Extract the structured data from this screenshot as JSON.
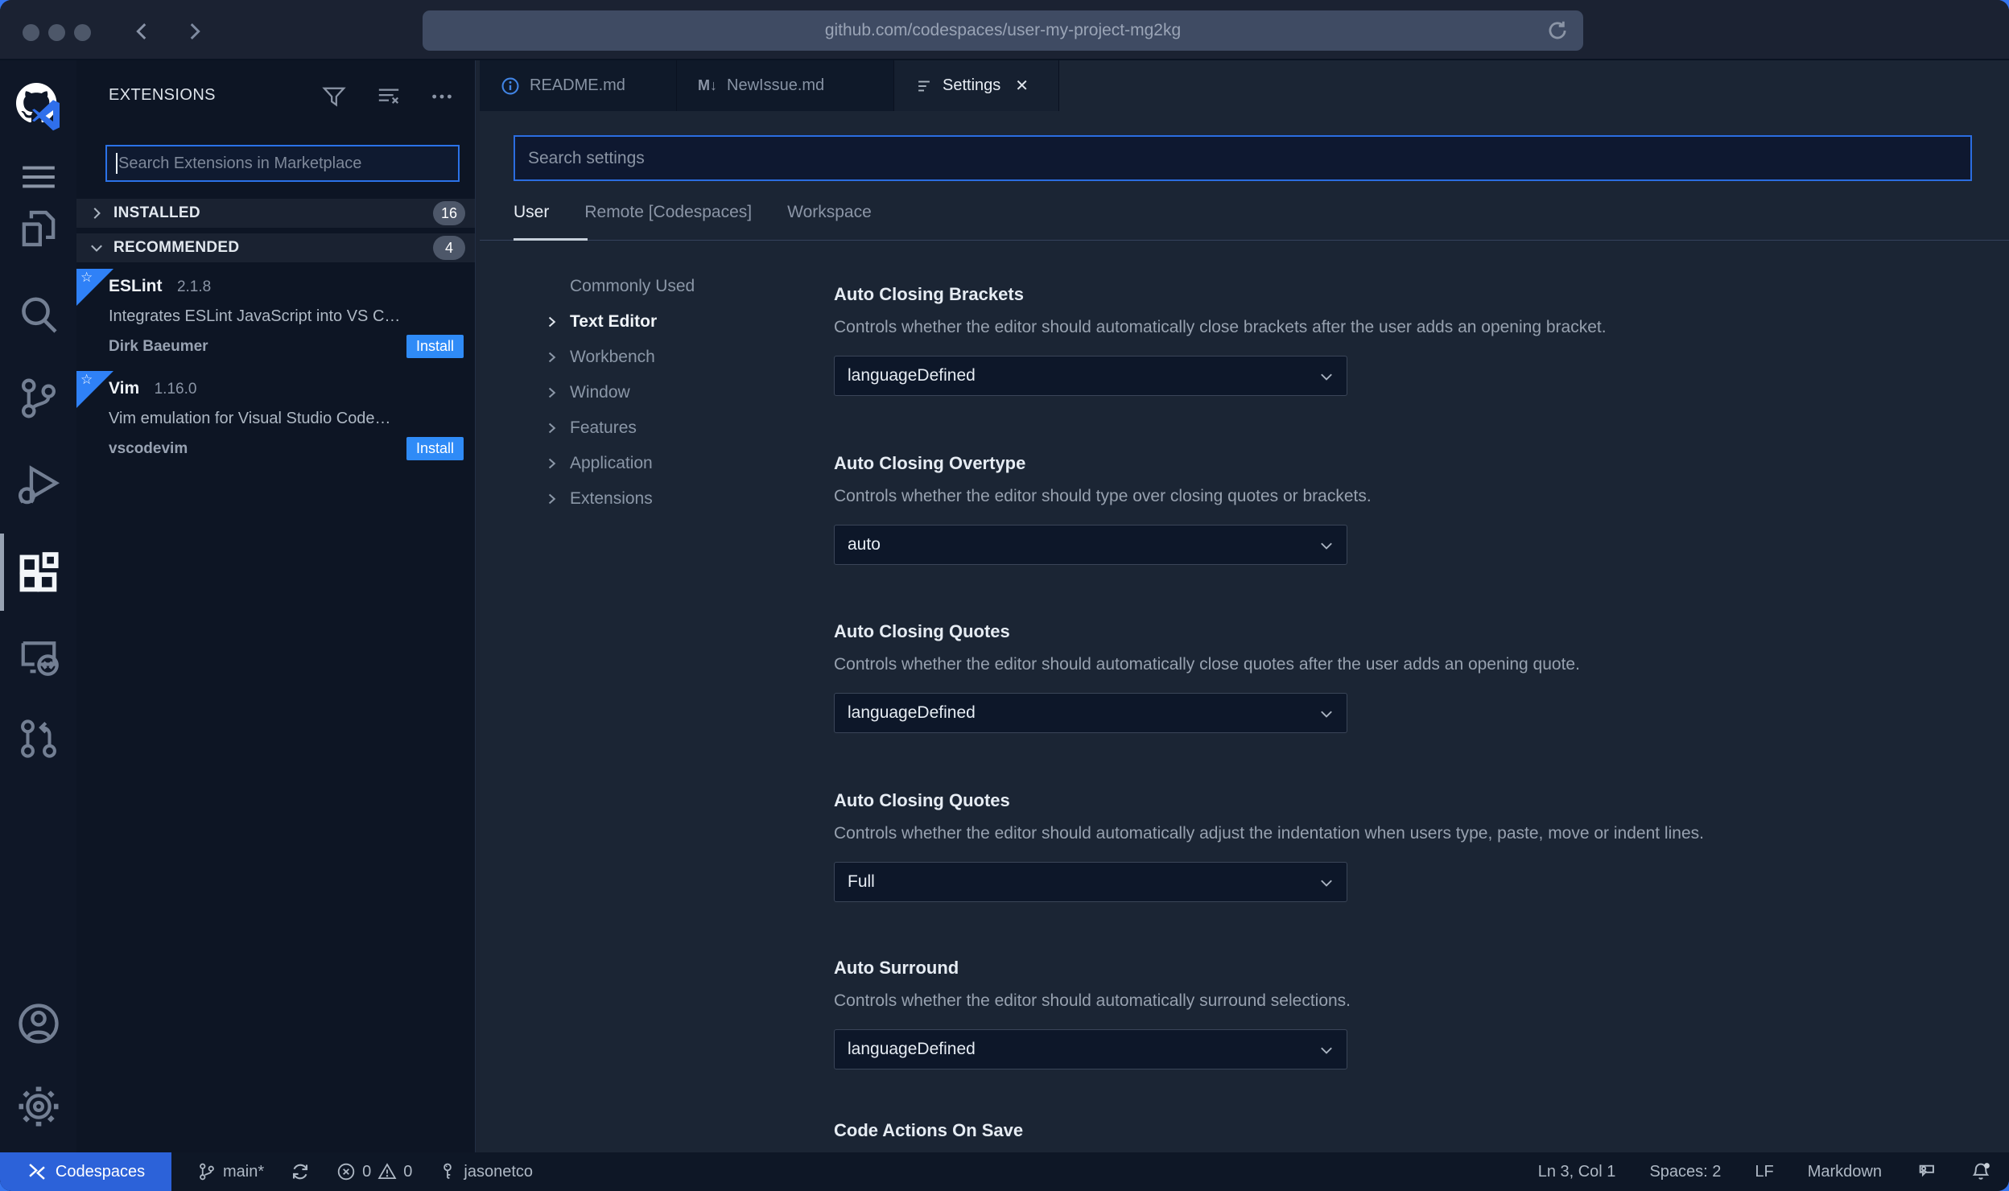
{
  "browser": {
    "url": "github.com/codespaces/user-my-project-mg2kg"
  },
  "sidebar": {
    "title": "EXTENSIONS",
    "search_placeholder": "Search Extensions in Marketplace",
    "sections": [
      {
        "label": "INSTALLED",
        "count": "16"
      },
      {
        "label": "RECOMMENDED",
        "count": "4"
      }
    ],
    "extensions": [
      {
        "name": "ESLint",
        "version": "2.1.8",
        "description": "Integrates ESLint JavaScript into VS C…",
        "publisher": "Dirk Baeumer",
        "action": "Install"
      },
      {
        "name": "Vim",
        "version": "1.16.0",
        "description": "Vim emulation for Visual Studio Code…",
        "publisher": "vscodevim",
        "action": "Install"
      }
    ]
  },
  "tabs": [
    {
      "label": "README.md"
    },
    {
      "label": "NewIssue.md"
    },
    {
      "label": "Settings"
    }
  ],
  "settings": {
    "search_placeholder": "Search settings",
    "scopes": [
      "User",
      "Remote [Codespaces]",
      "Workspace"
    ],
    "toc": [
      "Commonly Used",
      "Text Editor",
      "Workbench",
      "Window",
      "Features",
      "Application",
      "Extensions"
    ],
    "items": [
      {
        "title": "Auto Closing Brackets",
        "description": "Controls whether the editor should automatically close brackets after the user adds an opening bracket.",
        "value": "languageDefined"
      },
      {
        "title": "Auto Closing Overtype",
        "description": "Controls whether the editor should type over closing quotes or brackets.",
        "value": "auto"
      },
      {
        "title": "Auto Closing Quotes",
        "description": "Controls whether the editor should automatically close quotes after the user adds an opening quote.",
        "value": "languageDefined"
      },
      {
        "title": "Auto Closing Quotes",
        "description": "Controls whether the editor should automatically adjust the indentation when users type, paste, move or indent lines.",
        "value": "Full"
      },
      {
        "title": "Auto Surround",
        "description": "Controls whether the editor should automatically surround selections.",
        "value": "languageDefined"
      },
      {
        "title": "Code Actions On Save"
      }
    ]
  },
  "status_bar": {
    "codespaces": "Codespaces",
    "branch": "main*",
    "errors": "0",
    "warnings": "0",
    "user": "jasonetco",
    "cursor": "Ln 3, Col 1",
    "indent": "Spaces: 2",
    "eol": "LF",
    "language": "Markdown"
  },
  "colors": {
    "accent": "#2f81f7",
    "install_button": "#2f8bf7",
    "codespaces_bg": "#2c62d9",
    "editor_bg": "#1b2534",
    "sidebar_bg": "#0d1524",
    "statusbar_bg": "#0e1726"
  }
}
